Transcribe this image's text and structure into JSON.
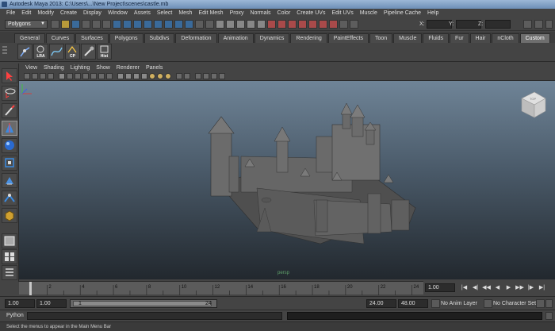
{
  "window": {
    "title": "Autodesk Maya 2013: C:\\Users\\...\\New Project\\scenes\\castle.mb"
  },
  "menubar": [
    "File",
    "Edit",
    "Modify",
    "Create",
    "Display",
    "Window",
    "Assets",
    "Select",
    "Mesh",
    "Edit Mesh",
    "Proxy",
    "Normals",
    "Color",
    "Create UVs",
    "Edit UVs",
    "Muscle",
    "Pipeline Cache",
    "Help"
  ],
  "status_line": {
    "mode": "Polygons",
    "x_label": "X:",
    "y_label": "Y:",
    "z_label": "Z:"
  },
  "shelf_tabs": [
    "General",
    "Curves",
    "Surfaces",
    "Polygons",
    "Subdivs",
    "Deformation",
    "Animation",
    "Dynamics",
    "Rendering",
    "PaintEffects",
    "Toon",
    "Muscle",
    "Fluids",
    "Fur",
    "Hair",
    "nCloth",
    "Custom"
  ],
  "active_shelf_tab": "Custom",
  "shelf_buttons": [
    {
      "label": "",
      "icon": "joint-icon"
    },
    {
      "label": "LRA",
      "icon": "lra-icon"
    },
    {
      "label": "",
      "icon": "curve-icon"
    },
    {
      "label": "CP",
      "icon": "cp-icon"
    },
    {
      "label": "",
      "icon": "tool-icon"
    },
    {
      "label": "Hist",
      "icon": "history-icon"
    }
  ],
  "viewport_menu": [
    "View",
    "Shading",
    "Lighting",
    "Show",
    "Renderer",
    "Panels"
  ],
  "viewport": {
    "camera_label": "persp",
    "viewcube_label": "TOP"
  },
  "timeline": {
    "ticks": [
      "2",
      "4",
      "6",
      "8",
      "10",
      "12",
      "14",
      "16",
      "18",
      "20",
      "22",
      "24"
    ],
    "current_frame": "1.00"
  },
  "range": {
    "start": "1.00",
    "playback_start": "1.00",
    "slider_start": "1",
    "slider_end": "24",
    "playback_end": "24.00",
    "end": "48.00",
    "anim_layer": "No Anim Layer",
    "character_set": "No Character Set"
  },
  "command_line": {
    "label": "Python"
  },
  "help_line": "Select the menus to appear in the Main Menu Bar"
}
